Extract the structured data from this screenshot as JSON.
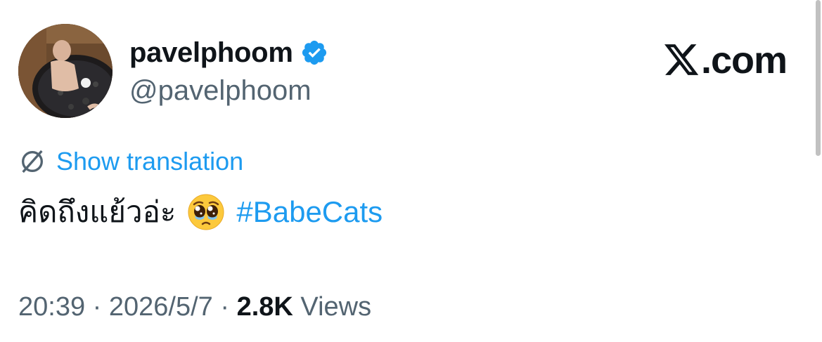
{
  "author": {
    "display_name": "pavelphoom",
    "handle": "@pavelphoom",
    "verified": true
  },
  "brand": {
    "text": ".com",
    "logo_icon": "x-logo-icon"
  },
  "translation": {
    "label": "Show translation",
    "icon": "translate-icon"
  },
  "tweet": {
    "text": "คิดถึงแย้วอ่ะ",
    "emoji": "pleading-face-emoji",
    "hashtag": "#BabeCats"
  },
  "meta": {
    "time": "20:39",
    "separator": "·",
    "date": "2026/5/7",
    "views_count": "2.8K",
    "views_label": "Views"
  },
  "colors": {
    "link": "#1d9bf0",
    "text": "#0f1419",
    "secondary": "#536471",
    "verified": "#1d9bf0"
  }
}
